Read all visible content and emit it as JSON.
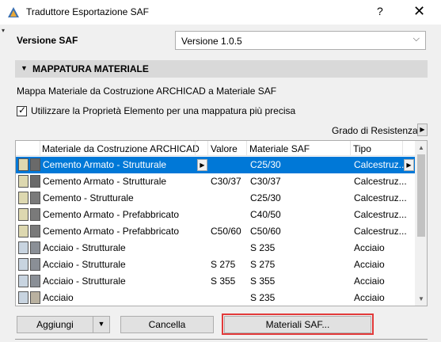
{
  "window": {
    "title": "Traduttore Esportazione SAF",
    "help_glyph": "?",
    "close_glyph": "✕",
    "app_icon": "archicad-app-icon",
    "side_marker": "▾"
  },
  "version": {
    "label": "Versione SAF",
    "selected": "Versione 1.0.5",
    "chevron": "⌵"
  },
  "section": {
    "collapse_glyph": "▼",
    "title": "MAPPATURA MATERIALE"
  },
  "mapping": {
    "description": "Mappa  Materiale da Costruzione ARCHICAD a Materiale SAF",
    "checkbox_checked": true,
    "checkbox_tick": "✓",
    "checkbox_label": "Utilizzare la Proprietà Elemento per una mappatura più precisa",
    "grado_label": "Grado di Resistenza",
    "arrow_glyph": "▶"
  },
  "table": {
    "columns": [
      "Materiale da Costruzione ARCHICAD",
      "Valore",
      "Materiale SAF",
      "Tipo"
    ],
    "rows": [
      {
        "material": "Cemento Armato - Strutturale",
        "valore": "",
        "saf": "C25/30",
        "tipo": "Calcestruz...",
        "selected": true,
        "sw1": "#ddd8b0",
        "sw2": "#6a6a6a"
      },
      {
        "material": "Cemento Armato - Strutturale",
        "valore": "C30/37",
        "saf": "C30/37",
        "tipo": "Calcestruz...",
        "selected": false,
        "sw1": "#ddd8b0",
        "sw2": "#6a6a6a"
      },
      {
        "material": "Cemento - Strutturale",
        "valore": "",
        "saf": "C25/30",
        "tipo": "Calcestruz...",
        "selected": false,
        "sw1": "#ddd8b0",
        "sw2": "#7a7a7a"
      },
      {
        "material": "Cemento Armato - Prefabbricato",
        "valore": "",
        "saf": "C40/50",
        "tipo": "Calcestruz...",
        "selected": false,
        "sw1": "#ddd8b0",
        "sw2": "#7a7a7a"
      },
      {
        "material": "Cemento Armato - Prefabbricato",
        "valore": "C50/60",
        "saf": "C50/60",
        "tipo": "Calcestruz...",
        "selected": false,
        "sw1": "#ddd8b0",
        "sw2": "#7a7a7a"
      },
      {
        "material": "Acciaio - Strutturale",
        "valore": "",
        "saf": "S 235",
        "tipo": "Acciaio",
        "selected": false,
        "sw1": "#c8d4e0",
        "sw2": "#8a8f96"
      },
      {
        "material": "Acciaio - Strutturale",
        "valore": "S 275",
        "saf": "S 275",
        "tipo": "Acciaio",
        "selected": false,
        "sw1": "#c8d4e0",
        "sw2": "#8a8f96"
      },
      {
        "material": "Acciaio - Strutturale",
        "valore": "S 355",
        "saf": "S 355",
        "tipo": "Acciaio",
        "selected": false,
        "sw1": "#c8d4e0",
        "sw2": "#8a8f96"
      },
      {
        "material": "Acciaio",
        "valore": "",
        "saf": "S 235",
        "tipo": "Acciaio",
        "selected": false,
        "sw1": "#c8d4e0",
        "sw2": "#b9b1a0"
      }
    ],
    "scroll_up": "▲",
    "scroll_down": "▼"
  },
  "buttons": {
    "add": "Aggiungi",
    "add_dropdown": "▼",
    "delete": "Cancella",
    "saf_materials": "Materiali SAF..."
  },
  "colors": {
    "selection": "#0078d7",
    "highlight": "#e23a3a"
  }
}
